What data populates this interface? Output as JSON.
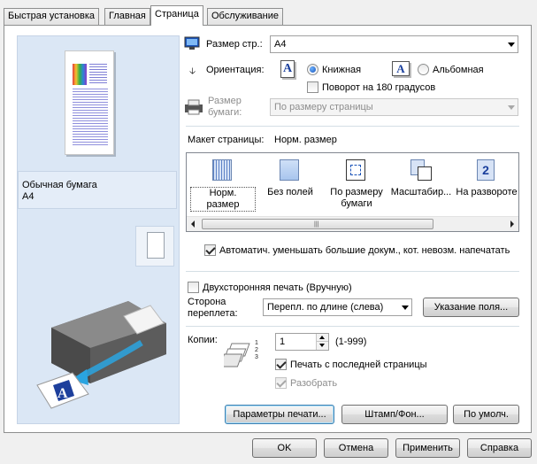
{
  "tabs": [
    {
      "label": "Быстрая установка"
    },
    {
      "label": "Главная"
    },
    {
      "label": "Страница"
    },
    {
      "label": "Обслуживание"
    }
  ],
  "preview": {
    "media_line1": "Обычная бумага",
    "media_line2": "A4"
  },
  "page_size": {
    "label": "Размер стр.:",
    "value": "A4"
  },
  "orientation": {
    "label": "Ориентация:",
    "portrait": "Книжная",
    "landscape": "Альбомная",
    "portrait_icon_letter": "A",
    "landscape_icon_letter": "A",
    "rotate": "Поворот на 180 градусов"
  },
  "paper_size": {
    "label_line1": "Размер",
    "label_line2": "бумаги:",
    "value": "По размеру страницы"
  },
  "layout": {
    "label": "Макет страницы:",
    "current": "Норм. размер",
    "items": [
      {
        "line1": "Норм.",
        "line2": "размер"
      },
      {
        "line1": "Без полей",
        "line2": ""
      },
      {
        "line1": "По размеру",
        "line2": "бумаги"
      },
      {
        "line1": "Масштабир...",
        "line2": ""
      },
      {
        "line1": "На развороте",
        "line2": ""
      }
    ],
    "booklet_number": "2",
    "scroll_grip": "|||"
  },
  "auto_reduce": "Автоматич. уменьшать большие докум., кот. невозм. напечатать",
  "duplex": {
    "label": "Двухсторонняя печать (Вручную)",
    "binding_label_line1": "Сторона",
    "binding_label_line2": "переплета:",
    "binding_value": "Перепл. по длине (слева)",
    "margin_button": "Указание поля..."
  },
  "copies": {
    "label": "Копии:",
    "value": "1",
    "range": "(1-999)",
    "print_from_last": "Печать с последней страницы",
    "collate": "Разобрать",
    "order_numbers": "1 2 3"
  },
  "bottom_buttons": {
    "print_options": "Параметры печати...",
    "stamp": "Штамп/Фон...",
    "defaults": "По умолч."
  },
  "dialog_buttons": {
    "ok": "OK",
    "cancel": "Отмена",
    "apply": "Применить",
    "help": "Справка"
  },
  "illustration_letter": "A",
  "colors": {
    "accent": "#1a53b8",
    "preview_bg": "#dbe7f5",
    "arrow": "#2aa4e0"
  }
}
